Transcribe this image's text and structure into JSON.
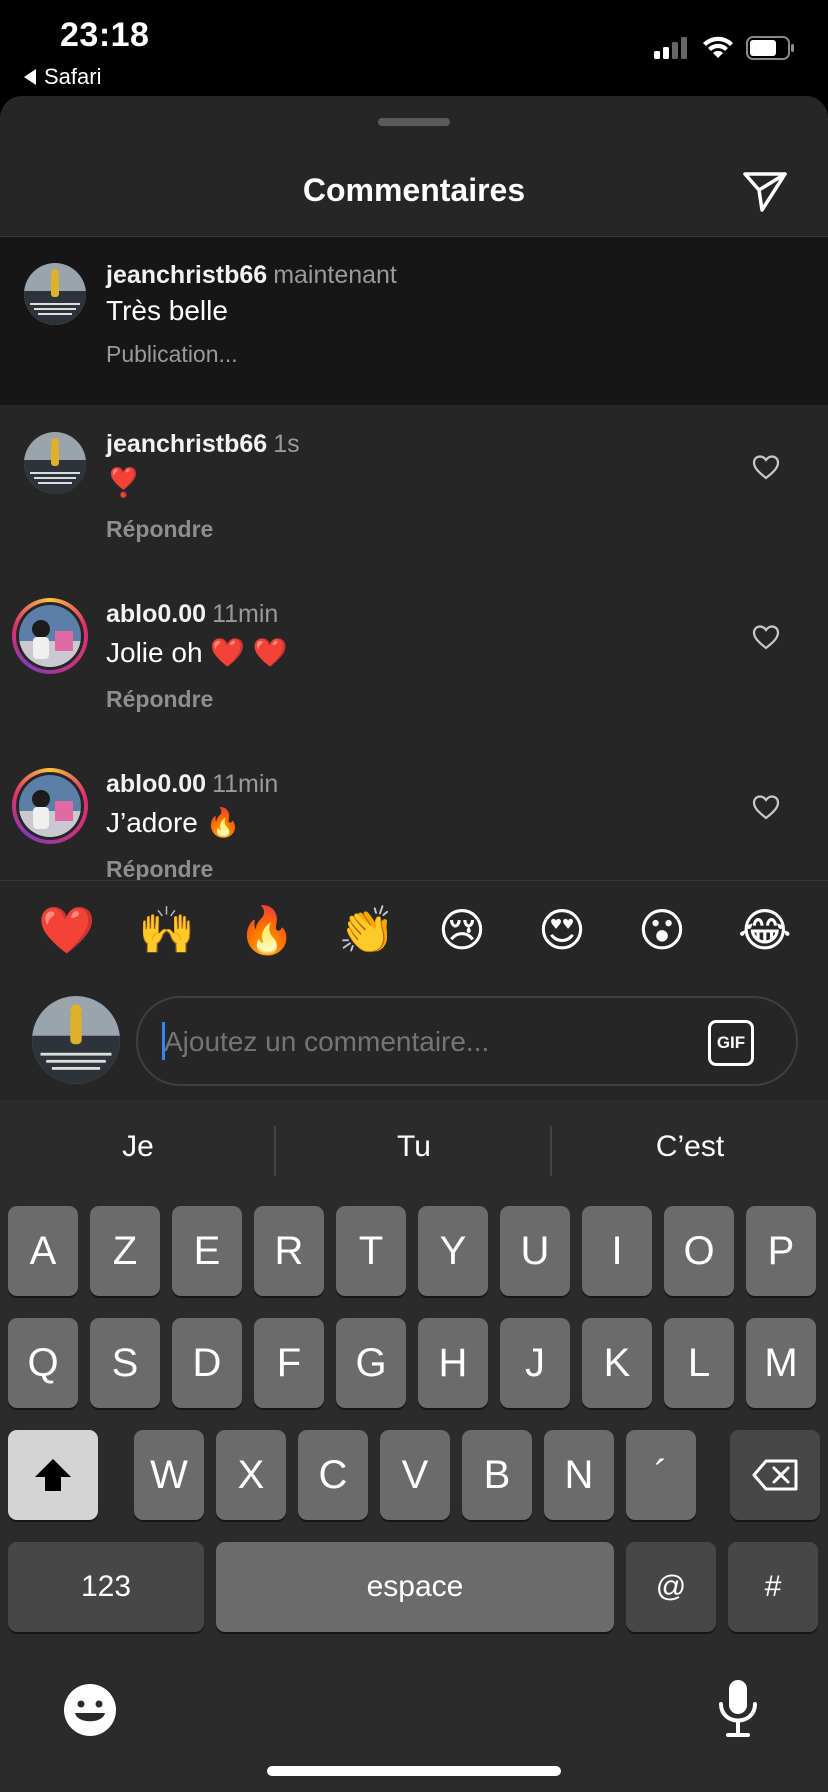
{
  "status_bar": {
    "time": "23:18",
    "back_app": "Safari",
    "icons": [
      "signal-icon",
      "wifi-icon",
      "battery-icon"
    ]
  },
  "sheet": {
    "title": "Commentaires",
    "send_icon": "paper-plane-icon"
  },
  "caption": {
    "username": "jeanchristb66",
    "time": "maintenant",
    "text": "Très belle",
    "subtext": "Publication..."
  },
  "comments": [
    {
      "username": "jeanchristb66",
      "time": "1s",
      "text": "❣️",
      "reply": "Répondre"
    },
    {
      "username": "ablo0.00",
      "time": "11min",
      "text": "Jolie oh ❤️ ❤️",
      "reply": "Répondre"
    },
    {
      "username": "ablo0.00",
      "time": "11min",
      "text": "J’adore 🔥",
      "reply": "Répondre"
    }
  ],
  "reactions": [
    "❤️",
    "🙌",
    "🔥",
    "👏",
    "😢",
    "😍",
    "😮",
    "😂"
  ],
  "input": {
    "placeholder": "Ajoutez un commentaire...",
    "gif_label": "GIF"
  },
  "keyboard": {
    "suggestions": [
      "Je",
      "Tu",
      "C’est"
    ],
    "row1": [
      "A",
      "Z",
      "E",
      "R",
      "T",
      "Y",
      "U",
      "I",
      "O",
      "P"
    ],
    "row2": [
      "Q",
      "S",
      "D",
      "F",
      "G",
      "H",
      "J",
      "K",
      "L",
      "M"
    ],
    "row3": [
      "W",
      "X",
      "C",
      "V",
      "B",
      "N",
      "´"
    ],
    "numbers_label": "123",
    "space_label": "espace",
    "at_label": "@",
    "hash_label": "#"
  },
  "colors": {
    "sheet_bg": "#262626",
    "caption_bg": "#161616",
    "keyboard_bg": "#2b2b2b",
    "story_ring": "#e1306c"
  }
}
